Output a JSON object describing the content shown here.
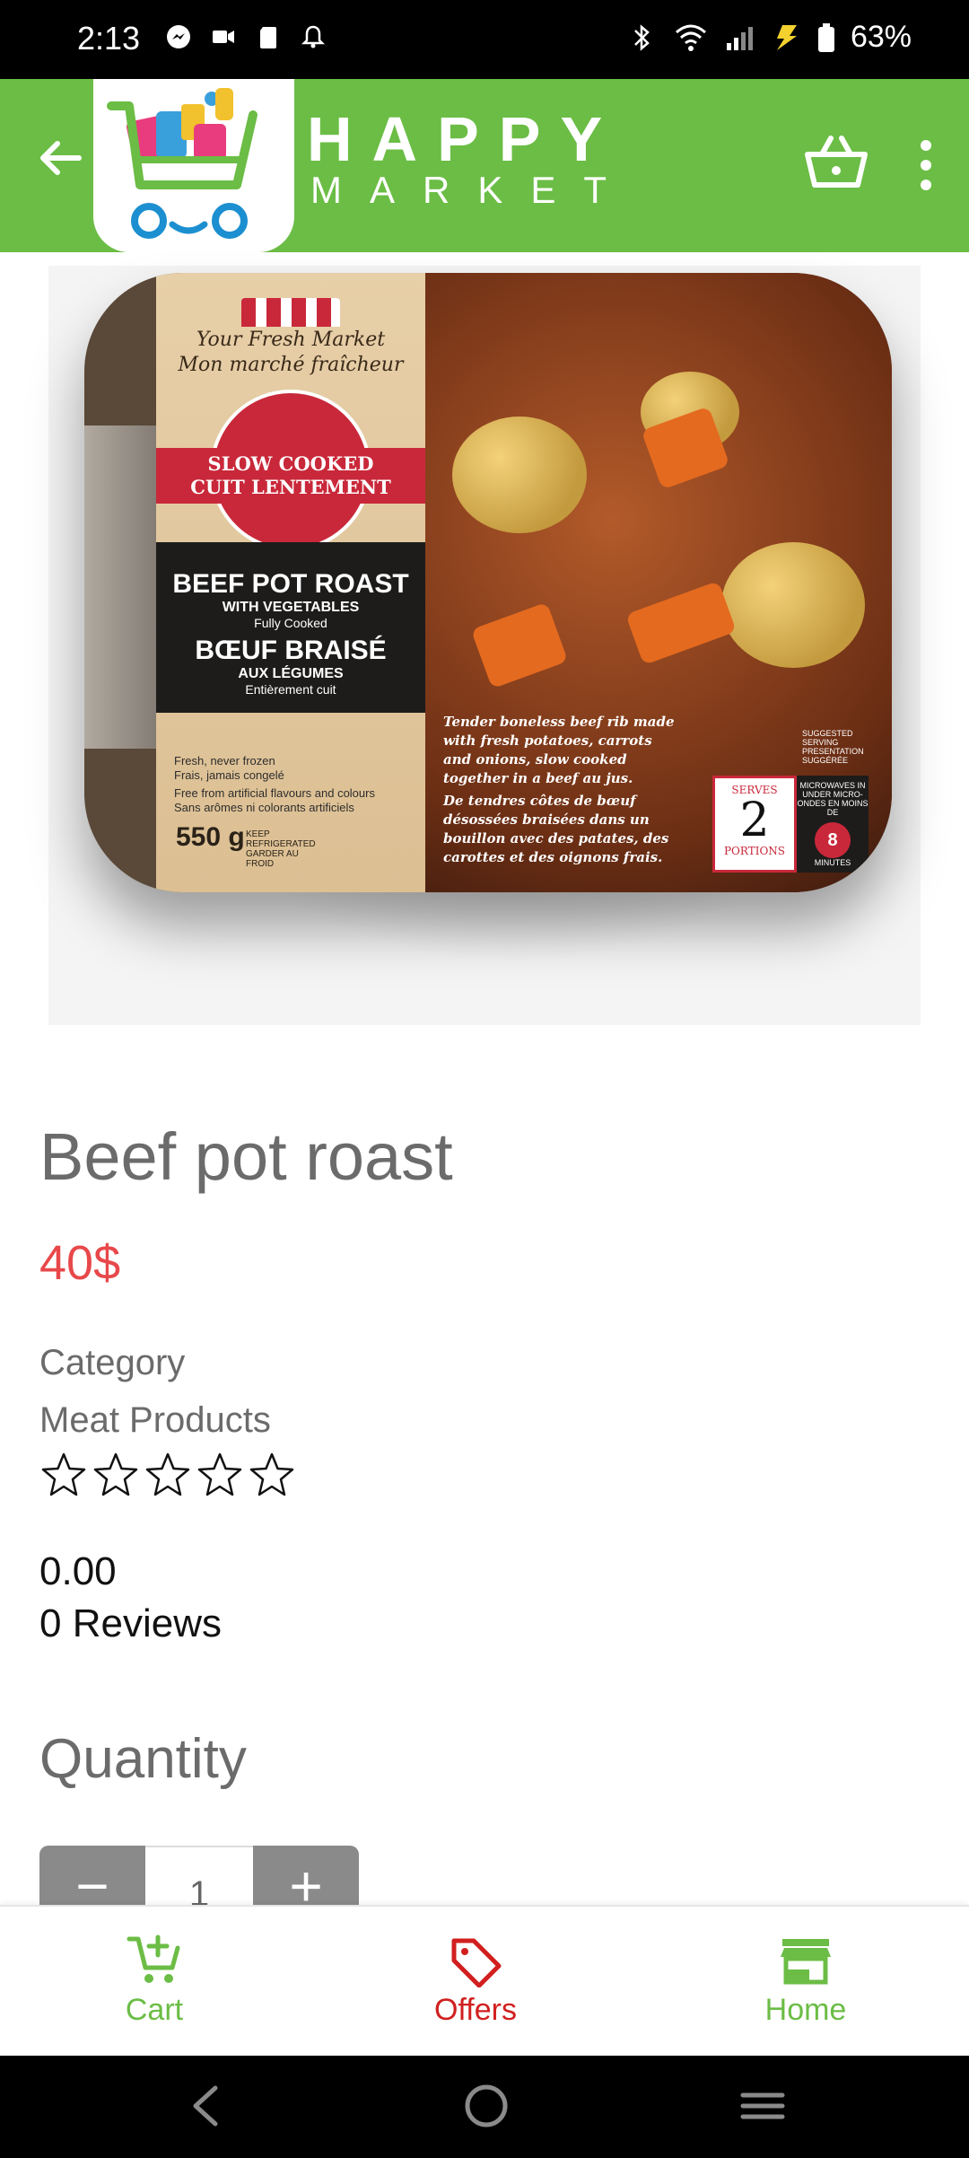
{
  "status_bar": {
    "time": "2:13",
    "battery": "63%",
    "left_icons": [
      "messenger-icon",
      "video-icon",
      "sd-card-icon",
      "bell-icon"
    ],
    "right_icons": [
      "bluetooth-icon",
      "wifi-icon",
      "signal-icon",
      "charging-icon",
      "battery-icon"
    ]
  },
  "app_bar": {
    "brand_line1": "HAPPY",
    "brand_line2": "MARKET",
    "color": "#6bbd45"
  },
  "product_image": {
    "brand_script_en": "Your Fresh Market",
    "brand_script_fr": "Mon marché fraîcheur",
    "band_line1": "SLOW COOKED",
    "band_line2": "CUIT LENTEMENT",
    "name_en": "BEEF POT ROAST",
    "sub_en": "WITH VEGETABLES",
    "cooked_en": "Fully Cooked",
    "name_fr": "BŒUF BRAISÉ",
    "sub_fr": "AUX LÉGUMES",
    "cooked_fr": "Entièrement cuit",
    "check1_en": "Fresh, never frozen",
    "check1_fr": "Frais, jamais congelé",
    "check2_en": "Free from artificial flavours and colours",
    "check2_fr": "Sans arômes ni colorants artificiels",
    "weight": "550 g",
    "weight_note": "KEEP REFRIGERATED GARDER AU FROID",
    "desc_en": "Tender boneless beef rib made with fresh potatoes, carrots and onions, slow cooked together in a beef au jus.",
    "desc_fr": "De tendres côtes de bœuf désossées braisées dans un bouillon avec des patates, des carottes et des oignons frais.",
    "suggested": "SUGGESTED SERVING PRESENTATION SUGGÉRÉE",
    "serves_label": "SERVES",
    "serves_value": "2",
    "portions_label": "PORTIONS",
    "micro_text": "MICROWAVES IN UNDER MICRO-ONDES EN MOINS DE",
    "micro_value": "8",
    "micro_unit": "MINUTES"
  },
  "product": {
    "title": "Beef pot roast",
    "price": "40$",
    "category_label": "Category",
    "category_value": "Meat Products",
    "rating_stars": 0,
    "rating_value": "0.00",
    "reviews": "0 Reviews",
    "quantity_label": "Quantity",
    "quantity_value": "1",
    "minus_label": "−",
    "plus_label": "+"
  },
  "bottom_nav": {
    "items": [
      {
        "label": "Cart",
        "icon": "cart-add-icon",
        "color": "#6bbd45"
      },
      {
        "label": "Offers",
        "icon": "tag-icon",
        "color": "#d11f1f"
      },
      {
        "label": "Home",
        "icon": "store-icon",
        "color": "#6bbd45"
      }
    ]
  },
  "system_nav": {
    "icons": [
      "back-icon",
      "home-circle-icon",
      "recents-icon"
    ]
  }
}
